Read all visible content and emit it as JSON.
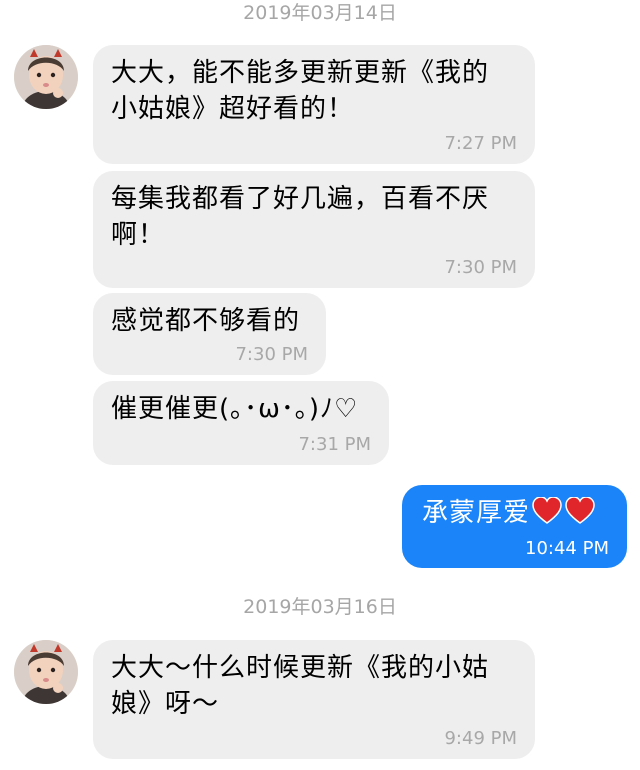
{
  "conversation": {
    "date1": "2019年03月14日",
    "date2": "2019年03月16日",
    "messages": [
      {
        "text_line1": "大大，能不能多更新更新《我的",
        "text_line2": "小姑娘》超好看的！",
        "time": "7:27 PM"
      },
      {
        "text_line1": "每集我都看了好几遍，百看不厌",
        "text_line2": "啊！",
        "time": "7:30 PM"
      },
      {
        "text_line1": "感觉都不够看的",
        "time": "7:30 PM"
      },
      {
        "text_line1": "催更催更(｡･ω･｡)ﾉ♡",
        "time": "7:31 PM"
      },
      {
        "text_line1": "承蒙厚爱",
        "time": "10:44 PM"
      },
      {
        "text_line1": "大大～什么时候更新《我的小姑",
        "text_line2": "娘》呀～",
        "time": "9:49 PM"
      }
    ]
  },
  "colors": {
    "incoming_bubble": "#eeeeee",
    "outgoing_bubble": "#1a84f8",
    "timestamp": "#a8a8a8",
    "date_header": "#a6a6a6",
    "heart": "#e0262b"
  },
  "icons": {
    "avatar": "child-avatar-icon",
    "heart": "heart-icon"
  }
}
